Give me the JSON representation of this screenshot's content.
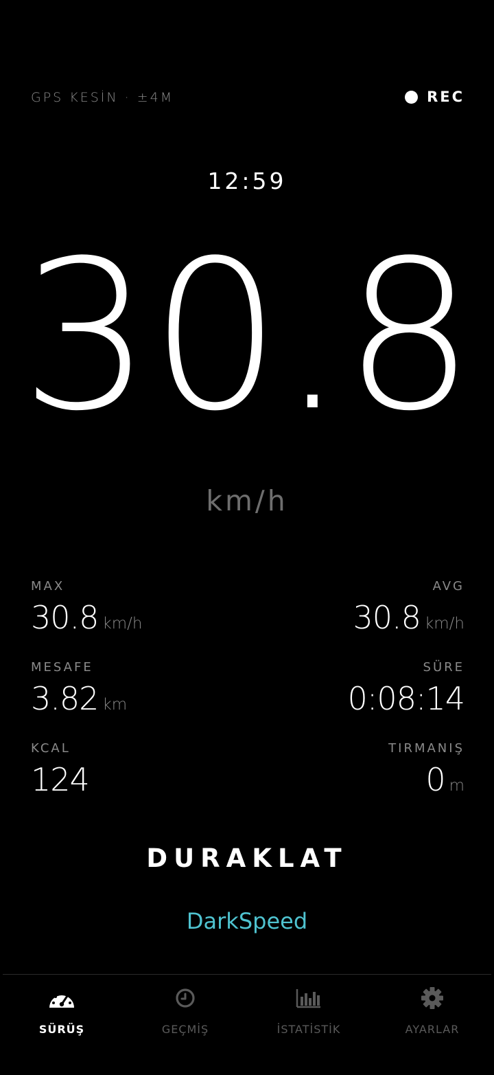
{
  "header": {
    "gps_status": "GPS KESİN · ±4M",
    "rec_label": "REC"
  },
  "clock": "12:59",
  "speed": {
    "value": "30.8",
    "unit": "km/h"
  },
  "stats": {
    "max": {
      "label": "MAX",
      "value": "30.8",
      "unit": "km/h"
    },
    "avg": {
      "label": "AVG",
      "value": "30.8",
      "unit": "km/h"
    },
    "distance": {
      "label": "MESAFE",
      "value": "3.82",
      "unit": "km"
    },
    "duration": {
      "label": "SÜRE",
      "value": "0:08:14"
    },
    "kcal": {
      "label": "KCAL",
      "value": "124"
    },
    "climb": {
      "label": "TIRMANIŞ",
      "value": "0",
      "unit": "m"
    }
  },
  "pause_label": "DURAKLAT",
  "brand": "DarkSpeed",
  "colors": {
    "background": "#000000",
    "brand": "#4fc3d0",
    "muted": "#8a8a8a",
    "nav_inactive": "#5a5a5a"
  },
  "nav": {
    "items": [
      {
        "label": "SÜRÜŞ",
        "icon": "speedometer-icon",
        "active": true
      },
      {
        "label": "GEÇMİŞ",
        "icon": "clock-icon",
        "active": false
      },
      {
        "label": "İSTATİSTİK",
        "icon": "bar-chart-icon",
        "active": false
      },
      {
        "label": "AYARLAR",
        "icon": "gear-icon",
        "active": false
      }
    ]
  }
}
